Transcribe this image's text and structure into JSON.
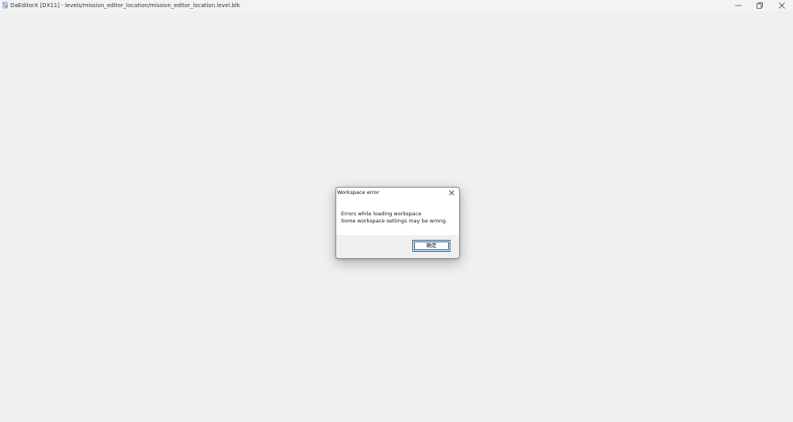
{
  "window": {
    "title": "DaEditorX  [DX11]  - levels/mission_editor_location/mission_editor_location.level.blk",
    "app_icon": "app-icon",
    "controls": [
      "minimize-icon",
      "restore-icon",
      "close-icon"
    ]
  },
  "dialog": {
    "title": "Workspace error",
    "message_line1": "Errors while loading workspace",
    "message_line2": "Some workspace settings may be wrong.",
    "ok_label": "确定",
    "close_icon": "close-icon"
  },
  "colors": {
    "background": "#f0f0f0",
    "dialog_background": "#ffffff",
    "focus_ring": "#0067c0"
  }
}
